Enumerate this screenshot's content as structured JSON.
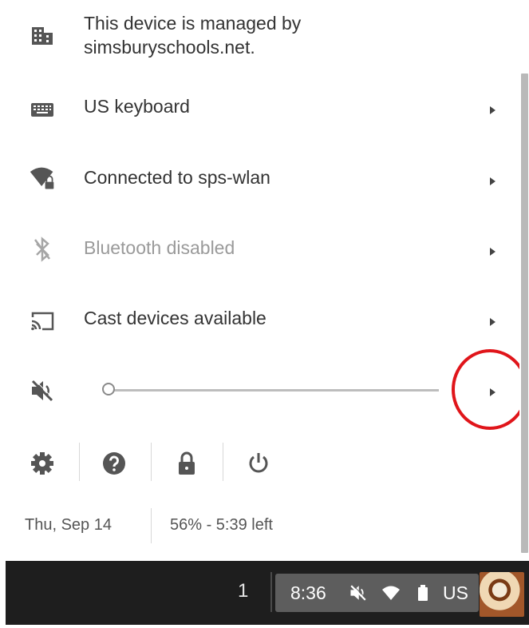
{
  "managed": {
    "icon": "building-icon",
    "text": "This device is managed by simsburyschools.net."
  },
  "rows": [
    {
      "icon": "keyboard-icon",
      "label": "US keyboard"
    },
    {
      "icon": "wifi-lock-icon",
      "label": "Connected to sps-wlan"
    },
    {
      "icon": "bluetooth-disabled-icon",
      "label": "Bluetooth disabled"
    },
    {
      "icon": "cast-icon",
      "label": "Cast devices available"
    }
  ],
  "volume": {
    "icon": "volume-muted-icon",
    "level": 0
  },
  "buttons": [
    "settings-icon",
    "help-icon",
    "lock-icon",
    "power-icon"
  ],
  "footer": {
    "date": "Thu, Sep 14",
    "battery": "56% - 5:39 left"
  },
  "shelf": {
    "count": "1",
    "time": "8:36",
    "status_icons": [
      "volume-muted-icon",
      "wifi-icon",
      "battery-icon"
    ],
    "lang": "US",
    "avatar": "user-avatar"
  },
  "colors": {
    "highlight": "#e0151a",
    "shelf": "#1e1e1e",
    "status_area": "#5d5d5d"
  }
}
